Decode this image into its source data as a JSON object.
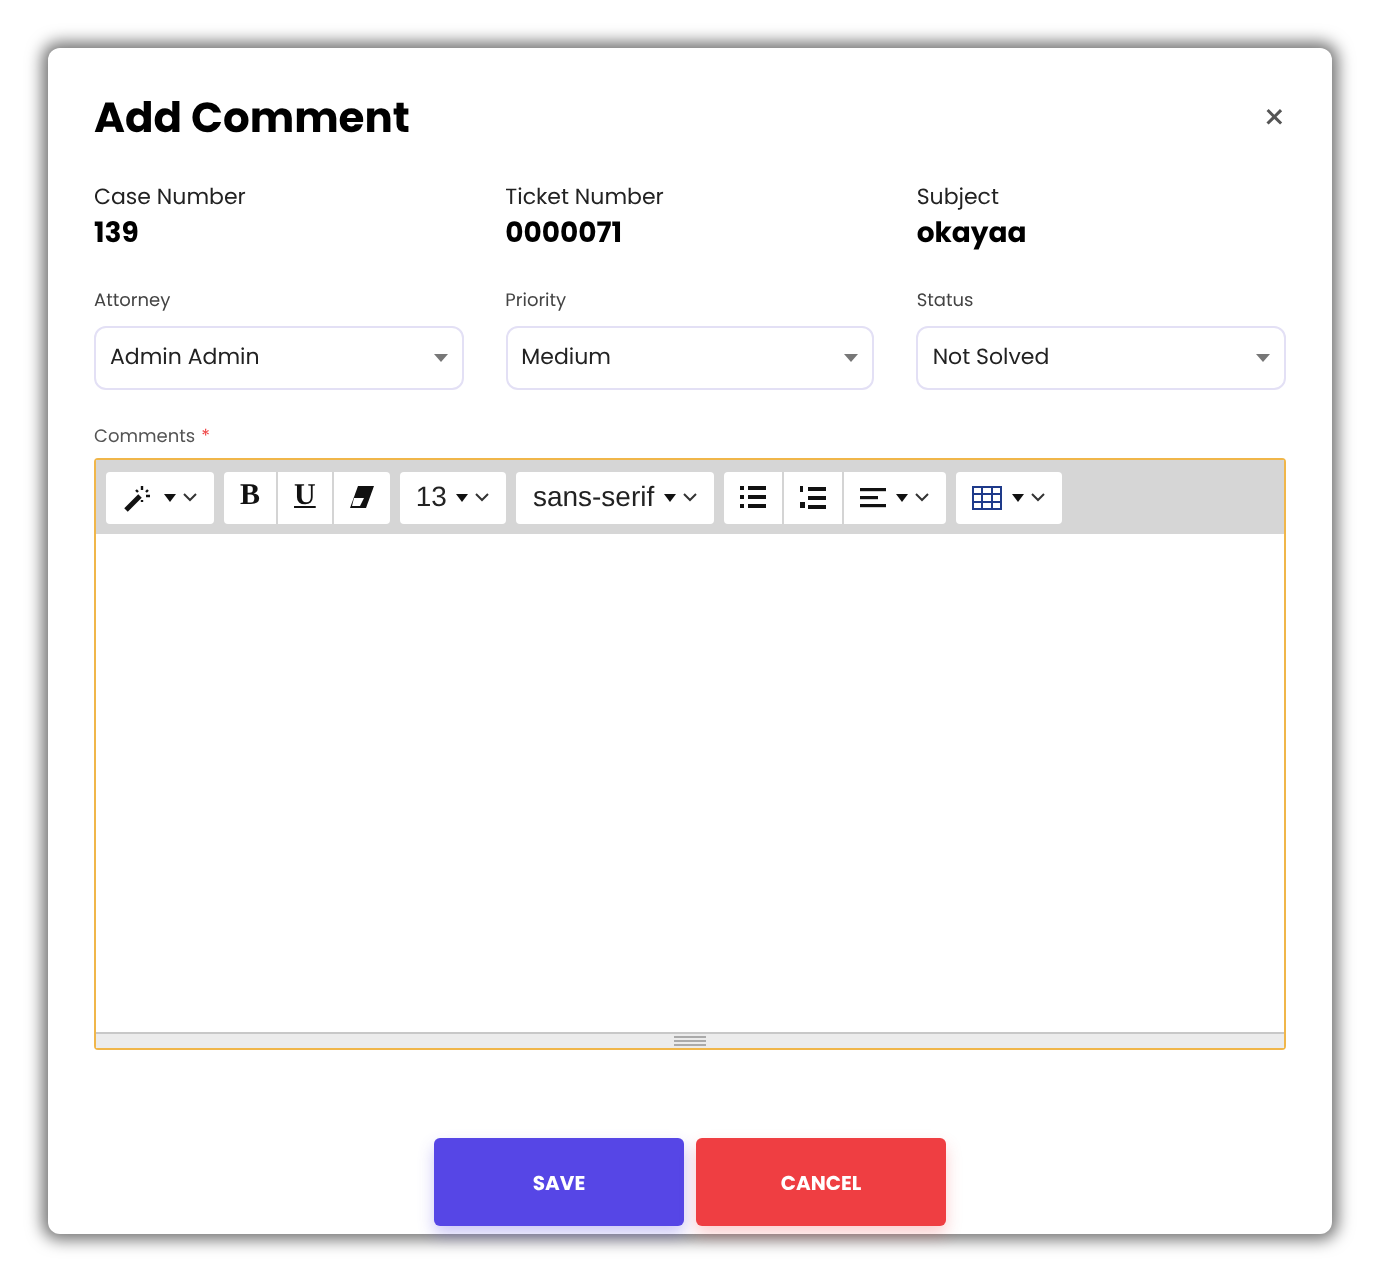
{
  "dialog": {
    "title": "Add Comment",
    "close": "×"
  },
  "info": [
    {
      "label": "Case Number",
      "value": "139"
    },
    {
      "label": "Ticket Number",
      "value": "0000071"
    },
    {
      "label": "Subject",
      "value": "okayaa"
    }
  ],
  "selects": [
    {
      "label": "Attorney",
      "value": "Admin Admin"
    },
    {
      "label": "Priority",
      "value": "Medium"
    },
    {
      "label": "Status",
      "value": "Not Solved"
    }
  ],
  "comments": {
    "label": "Comments",
    "required_mark": "*"
  },
  "toolbar": [
    [
      {
        "kind": "style",
        "dropdown": true
      }
    ],
    [
      {
        "kind": "bold",
        "text": "B"
      },
      {
        "kind": "underline",
        "text": "U"
      },
      {
        "kind": "eraser"
      }
    ],
    [
      {
        "kind": "text",
        "text": "13",
        "dropdown": true
      }
    ],
    [
      {
        "kind": "text",
        "text": "sans-serif",
        "dropdown": true
      }
    ],
    [
      {
        "kind": "ul"
      },
      {
        "kind": "ol"
      },
      {
        "kind": "align",
        "dropdown": true
      }
    ],
    [
      {
        "kind": "table",
        "dropdown": true
      }
    ]
  ],
  "buttons": [
    {
      "kind": "primary",
      "label": "SAVE"
    },
    {
      "kind": "danger",
      "label": "CANCEL"
    }
  ]
}
